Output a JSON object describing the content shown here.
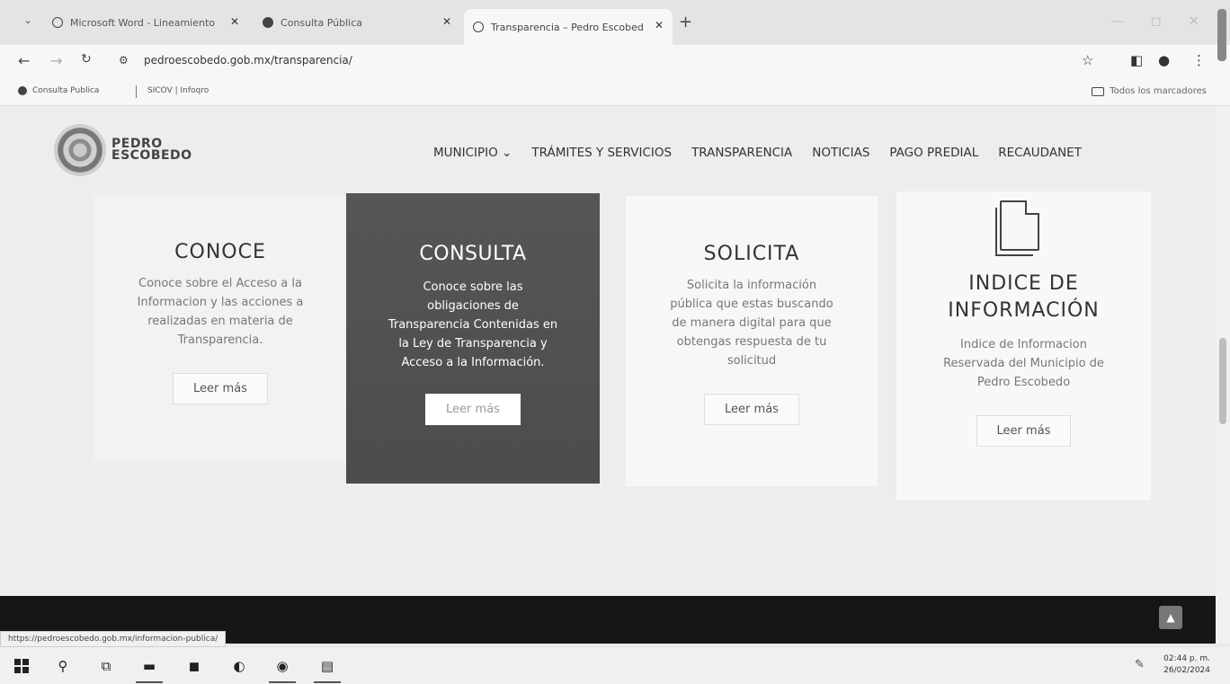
{
  "browser": {
    "tabs": [
      {
        "title": "Microsoft Word - Lineamiento",
        "active": false
      },
      {
        "title": "Consulta Pública",
        "active": false
      },
      {
        "title": "Transparencia – Pedro Escobed",
        "active": true
      }
    ],
    "close_glyph": "✕",
    "new_tab_glyph": "+",
    "url": "pedroescobedo.gob.mx/transparencia/",
    "bookmarks": [
      "Consulta Publica",
      "SICOV | Infoqro"
    ],
    "all_bookmarks_label": "Todos los marcadores",
    "status_url": "https://pedroescobedo.gob.mx/informacion-publica/"
  },
  "site": {
    "logo_line1": "PEDRO",
    "logo_line2": "ESCOBEDO",
    "nav": [
      "MUNICIPIO ⌄",
      "TRÁMITES Y SERVICIOS",
      "TRANSPARENCIA",
      "NOTICIAS",
      "PAGO PREDIAL",
      "RECAUDANET"
    ]
  },
  "cards": [
    {
      "title": "CONOCE",
      "lines": [
        "Conoce sobre el Acceso a la",
        "Informacion y las acciones a",
        "realizadas en materia de",
        "Transparencia."
      ],
      "button": "Leer más"
    },
    {
      "title": "CONSULTA",
      "lines": [
        "Conoce sobre las",
        "obligaciones de",
        "Transparencia Contenidas en",
        "la Ley de Transparencia y",
        "Acceso a la Información."
      ],
      "button": "Leer más"
    },
    {
      "title": "SOLICITA",
      "lines": [
        "Solicita la información",
        "pública que estas buscando",
        "de manera digital para que",
        "obtengas respuesta de tu",
        "solicitud"
      ],
      "button": "Leer más"
    },
    {
      "title_line1": "INDICE DE",
      "title_line2": "INFORMACIÓN",
      "lines": [
        "Indice de Informacion",
        "Reservada del Municipio de",
        "Pedro Escobedo"
      ],
      "button": "Leer más",
      "icon": "document-icon"
    }
  ],
  "taskbar": {
    "time": "02:44 p. m.",
    "date": "26/02/2024"
  },
  "colors": {
    "consulta_card_bg": "#505050",
    "footer_band": "#161616"
  }
}
